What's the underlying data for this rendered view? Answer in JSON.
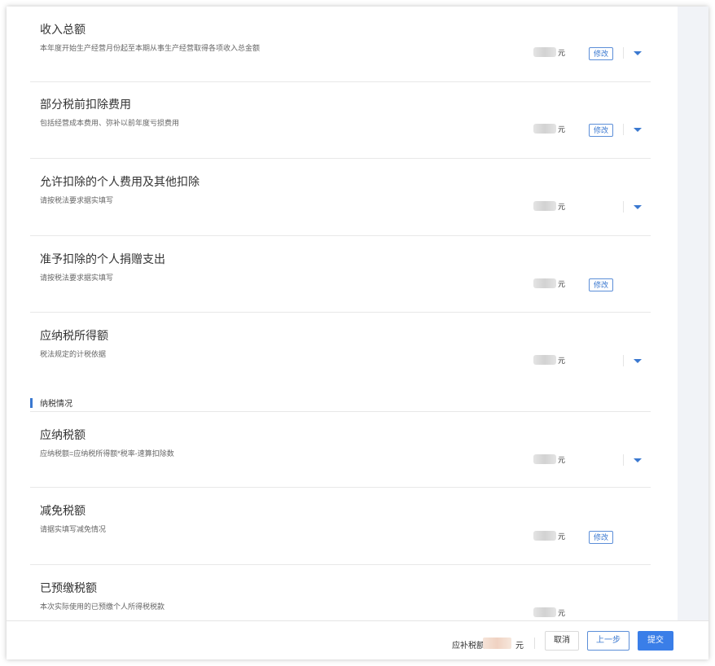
{
  "items": [
    {
      "title": "收入总额",
      "desc": "本年度开始生产经营月份起至本期从事生产经营取得各项收入总金额",
      "unit": "元",
      "edit": "修改"
    },
    {
      "title": "部分税前扣除费用",
      "desc": "包括经营成本费用、弥补以前年度亏损费用",
      "unit": "元",
      "edit": "修改"
    },
    {
      "title": "允许扣除的个人费用及其他扣除",
      "desc": "请按税法要求据实填写",
      "unit": "元"
    },
    {
      "title": "准予扣除的个人捐赠支出",
      "desc": "请按税法要求据实填写",
      "unit": "元",
      "edit": "修改"
    },
    {
      "title": "应纳税所得额",
      "desc": "税法规定的计税依据",
      "unit": "元"
    },
    {
      "title": "应纳税额",
      "desc": "应纳税额=应纳税所得额*税率-速算扣除数",
      "unit": "元"
    },
    {
      "title": "减免税额",
      "desc": "请据实填写减免情况",
      "unit": "元",
      "edit": "修改"
    },
    {
      "title": "已预缴税额",
      "desc": "本次实际使用的已预缴个人所得税税款",
      "unit": "元"
    }
  ],
  "section": {
    "label": "纳税情况"
  },
  "footer": {
    "due_label": "应补税额",
    "due_unit": "元",
    "cancel": "取消",
    "prev": "上一步",
    "submit": "提交"
  },
  "colors": {
    "accent": "#3a78d0",
    "primary_button": "#3a7ee8"
  }
}
